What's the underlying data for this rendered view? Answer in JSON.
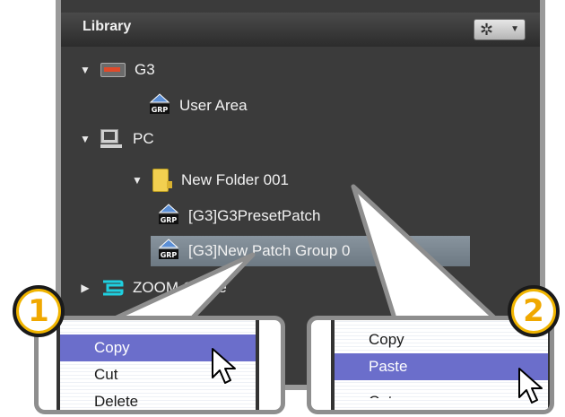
{
  "library": {
    "title": "Library",
    "tree": [
      {
        "label": "G3",
        "icon": "device-icon",
        "expanded": true
      },
      {
        "label": "User Area",
        "icon": "grp-icon"
      },
      {
        "label": "PC",
        "icon": "computer-icon",
        "expanded": true
      },
      {
        "label": "New Folder 001",
        "icon": "folder-icon",
        "expanded": true
      },
      {
        "label": "[G3]G3PresetPatch",
        "icon": "grp-icon"
      },
      {
        "label": "[G3]New Patch Group 0",
        "icon": "grp-icon",
        "selected": true
      },
      {
        "label": "ZOOM Online",
        "icon": "zoom-online-icon",
        "expanded": false
      }
    ]
  },
  "callout1": {
    "badge": "1",
    "menu": [
      {
        "label": "Copy",
        "highlighted": true
      },
      {
        "label": "Cut"
      },
      {
        "label": "Delete"
      }
    ]
  },
  "callout2": {
    "badge": "2",
    "menu": [
      {
        "label": "Copy"
      },
      {
        "label": "Paste",
        "highlighted": true
      },
      {
        "label": "Cut"
      }
    ]
  },
  "colors": {
    "panel_bg": "#3b3b3b",
    "selection": "#7a868f",
    "menu_highlight": "#6b6ecb",
    "badge": "#f0b400"
  }
}
